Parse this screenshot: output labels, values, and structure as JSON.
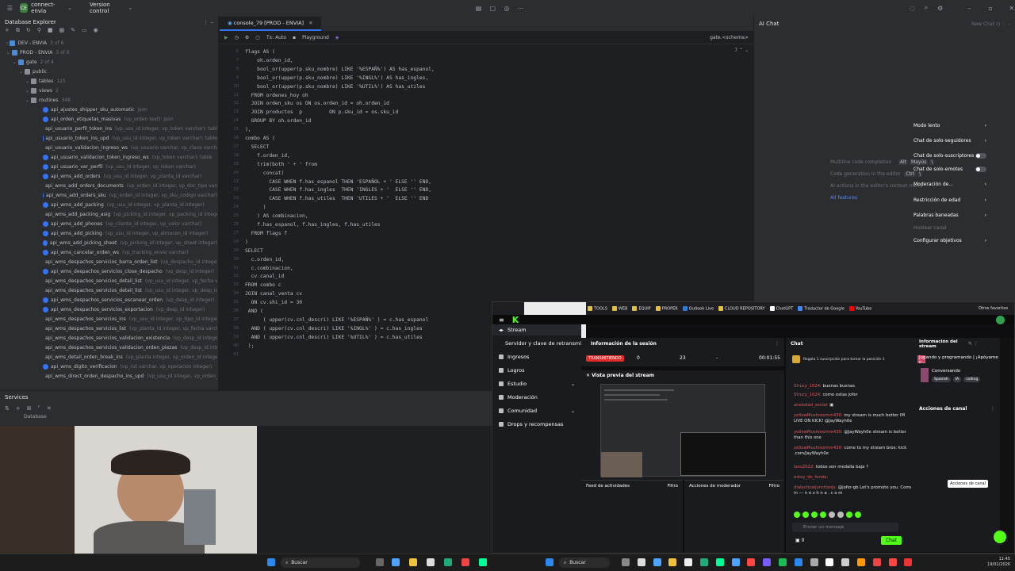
{
  "titlebar": {
    "project_badge": "CE",
    "project_name": "connect-envia",
    "vcs": "Version control"
  },
  "db_explorer": {
    "title": "Database Explorer",
    "nodes": [
      {
        "label": "DEV - ENVIA",
        "hint": "3 of 6"
      },
      {
        "label": "PROD - ENVIA",
        "hint": "3 of 6"
      },
      {
        "label": "gate",
        "hint": "2 of 4"
      },
      {
        "label": "public",
        "hint": ""
      },
      {
        "label": "tables",
        "hint": "125"
      },
      {
        "label": "views",
        "hint": "2"
      },
      {
        "label": "routines",
        "hint": "348"
      }
    ],
    "routines": [
      {
        "name": "api_ajustes_shipper_sku_automatic",
        "hint": "json"
      },
      {
        "name": "api_orden_etiquetas_masivas",
        "hint": "(vp_orden text): json"
      },
      {
        "name": "api_usuario_perfil_token_ins",
        "hint": "(vp_usu_id integer, vp_token varchar): table"
      },
      {
        "name": "api_usuario_token_ins_upd",
        "hint": "(vp_usu_id integer, vp_token varchar): table"
      },
      {
        "name": "api_usuario_validacion_ingreso_ws",
        "hint": "(vp_usuario varchar, vp_clave varchar)"
      },
      {
        "name": "api_usuario_validacion_token_ingreso_ws",
        "hint": "(vp_token varchar): table"
      },
      {
        "name": "api_usuario_ver_perfil",
        "hint": "(vp_usu_id integer, vp_token varchar)"
      },
      {
        "name": "api_wms_add_orders",
        "hint": "(vp_usu_id integer, vp_planta_id varchar)"
      },
      {
        "name": "api_wms_add_orders_documents",
        "hint": "(vp_orden_id integer, vp_doc_tipo varchar)"
      },
      {
        "name": "api_wms_add_orders_sku",
        "hint": "(vp_orden_id integer, vp_sku_codigo varchar)"
      },
      {
        "name": "api_wms_add_packing",
        "hint": "(vp_usu_id integer, vp_planta_id integer)"
      },
      {
        "name": "api_wms_add_packing_asig",
        "hint": "(vp_picking_id integer, vp_packing_id integer)"
      },
      {
        "name": "api_wms_add_phones",
        "hint": "(vp_cliente_id integer, vp_valor varchar)"
      },
      {
        "name": "api_wms_add_picking",
        "hint": "(vp_usu_id integer, vp_almacen_id integer)"
      },
      {
        "name": "api_wms_add_picking_sheet",
        "hint": "(vp_picking_id integer, vp_sheet integer)"
      },
      {
        "name": "api_wms_cancelar_orden_ws",
        "hint": "(vp_tracking_envio varchar)"
      },
      {
        "name": "api_wms_despachos_servicios_barra_orden_list",
        "hint": "(vp_despacho_id integer)"
      },
      {
        "name": "api_wms_despachos_servicios_close_despacho",
        "hint": "(vp_desp_id integer)"
      },
      {
        "name": "api_wms_despachos_servicios_detail_list",
        "hint": "(vp_usu_id integer, vp_fecha varchar)"
      },
      {
        "name": "api_wms_despachos_servicios_detail_list",
        "hint": "(vp_usu_id integer, vp_desp_id integer)"
      },
      {
        "name": "api_wms_despachos_servicios_escanear_orden",
        "hint": "(vp_desp_id integer)"
      },
      {
        "name": "api_wms_despachos_servicios_exportacion",
        "hint": "(vp_desp_id integer)"
      },
      {
        "name": "api_wms_despachos_servicios_ins",
        "hint": "(vp_usu_id integer, vp_tipo_id integer)"
      },
      {
        "name": "api_wms_despachos_servicios_list",
        "hint": "(vp_planta_id integer, vp_fecha varchar)"
      },
      {
        "name": "api_wms_despachos_servicios_validacion_existencia",
        "hint": "(vp_desp_id integer)"
      },
      {
        "name": "api_wms_despachos_servicios_validacion_orden_piezas",
        "hint": "(vp_desp_id integer)"
      },
      {
        "name": "api_wms_detail_orden_break_ins",
        "hint": "(vp_planta integer, vp_orden_id integer)"
      },
      {
        "name": "api_wms_digito_verificacion",
        "hint": "(vp_rut varchar, vp_operacion integer)"
      },
      {
        "name": "api_wms_direct_orden_despacho_ins_upd",
        "hint": "(vp_usu_id integer, vp_orden_id integer)"
      }
    ]
  },
  "services": {
    "title": "Services",
    "node": "Database"
  },
  "editor": {
    "tab": "console_79 [PROD - ENVIA]",
    "toolbar": {
      "tx": "Tx: Auto",
      "playground": "Playground",
      "schema": "gate.<schema>",
      "count": "7"
    },
    "lines": [
      {
        "n": "6",
        "t": "flags AS ("
      },
      {
        "n": "7",
        "t": "    oh.orden_id,"
      },
      {
        "n": "8",
        "t": "    bool_or(upper(p.sku_nombre) LIKE '%ESPAÑ%') AS has_espanol,"
      },
      {
        "n": "9",
        "t": "    bool_or(upper(p.sku_nombre) LIKE '%INGL%') AS has_ingles,"
      },
      {
        "n": "10",
        "t": "    bool_or(upper(p.sku_nombre) LIKE '%UTIL%') AS has_utiles"
      },
      {
        "n": "11",
        "t": "  FROM ordenes_hoy oh"
      },
      {
        "n": "12",
        "t": "  JOIN orden_sku os ON os.orden_id = oh.orden_id"
      },
      {
        "n": "13",
        "t": "  JOIN productos  p         ON p.sku_id = os.sku_id"
      },
      {
        "n": "14",
        "t": "  GROUP BY oh.orden_id"
      },
      {
        "n": "15",
        "t": "),"
      },
      {
        "n": "16",
        "t": "combo AS ("
      },
      {
        "n": "17",
        "t": "  SELECT"
      },
      {
        "n": "18",
        "t": "    f.orden_id,"
      },
      {
        "n": "19",
        "t": "    trim(both ' + ' from"
      },
      {
        "n": "20",
        "t": "      concat("
      },
      {
        "n": "21",
        "t": "        CASE WHEN f.has_espanol THEN 'ESPAÑOL + ' ELSE '' END,"
      },
      {
        "n": "22",
        "t": "        CASE WHEN f.has_ingles  THEN 'INGLES + '  ELSE '' END,"
      },
      {
        "n": "23",
        "t": "        CASE WHEN f.has_utiles  THEN 'UTILES + '  ELSE '' END"
      },
      {
        "n": "24",
        "t": "      )"
      },
      {
        "n": "25",
        "t": "    ) AS combinacion,"
      },
      {
        "n": "26",
        "t": "    f.has_espanol, f.has_ingles, f.has_utiles"
      },
      {
        "n": "27",
        "t": "  FROM flags f"
      },
      {
        "n": "28",
        "t": ")"
      },
      {
        "n": "29",
        "t": "SELECT"
      },
      {
        "n": "30",
        "t": "  c.orden_id,"
      },
      {
        "n": "31",
        "t": "  c.combinacion,"
      },
      {
        "n": "32",
        "t": "  cv.canal_id"
      },
      {
        "n": "33",
        "t": "FROM combo c"
      },
      {
        "n": "34",
        "t": "JOIN canal_venta cv"
      },
      {
        "n": "35",
        "t": "  ON cv.shi_id = 30"
      },
      {
        "n": "36",
        "t": " AND ("
      },
      {
        "n": "37",
        "t": "      ( upper(cv.cnl_descri) LIKE '%ESPAÑ%' ) = c.has_espanol"
      },
      {
        "n": "38",
        "t": "  AND ( upper(cv.cnl_descri) LIKE '%INGL%' ) = c.has_ingles"
      },
      {
        "n": "39",
        "t": "  AND ( upper(cv.cnl_descri) LIKE '%UTIL%' ) = c.has_utiles"
      },
      {
        "n": "40",
        "t": " );"
      },
      {
        "n": "41",
        "t": ""
      }
    ]
  },
  "ai_chat": {
    "title": "AI Chat",
    "new_chat": "New Chat",
    "hint1": "Multiline code completion",
    "hint1_keys": [
      "Alt",
      "Mayús",
      "\\"
    ],
    "hint2": "Code generation in the editor",
    "hint2_keys": [
      "Ctrl",
      "\\"
    ],
    "hint3": "AI actions in the editor's context menu",
    "all_features": "All features"
  },
  "browser": {
    "bookmarks": [
      "TOOLS",
      "WEB",
      "EQUIP",
      "PROPER",
      "Outlook Live",
      "CLOUD REPOSITORY",
      "ChatGPT",
      "Traductor de Google",
      "YouTube"
    ],
    "other_bookmarks": "Otros favoritos",
    "sidebar": {
      "stream": "Stream",
      "server_key": "Servidor y clave de retransmi...",
      "items": [
        "Ingresos",
        "Logros",
        "Estudio",
        "Moderación",
        "Comunidad",
        "Drops y recompensas"
      ]
    },
    "session": {
      "title": "Información de la sesión",
      "status": "TRANSMITIENDO",
      "viewers": "0",
      "followers": "23",
      "dash": "-",
      "time": "00:01:55"
    },
    "preview_title": "Vista previa del stream",
    "activity_feed": "Feed de actividades",
    "filter": "Filtro",
    "mod_actions": "Acciones de moderador",
    "filter2": "Filtro",
    "chat": {
      "title": "Chat",
      "gift": "Regala 1 suscripción para tomar la posición 1",
      "messages": [
        {
          "user": "Strucy_1024:",
          "text": " buenas buenas"
        },
        {
          "user": "Strucy_1024:",
          "text": " como estas jofer"
        },
        {
          "user": "ansiedad_social:",
          "text": " ▣"
        },
        {
          "user": "yellowMushroomm430:",
          "text": " my stream is much better IM LIVE ON KICK! @JayWayh0e"
        },
        {
          "user": "yellowMushroomm430:",
          "text": " @JayWayh0e stream is better than this one"
        },
        {
          "user": "yellowMushroomm430:",
          "text": " come to my stream bros: kick .com/JayWayh0e"
        },
        {
          "user": "lans2022:",
          "text": " todos son medalla baja ?"
        },
        {
          "user": "estoy_de_fondo:",
          "text": ""
        },
        {
          "user": "dialecticaljunctionjs:",
          "text": " @jofer-gb Let's promote you. Come in --- n e z h n a . c o m"
        }
      ],
      "input_placeholder": "Enviar un mensaje",
      "points": "0",
      "send": "Chat"
    },
    "right_panel": {
      "info_title": "Información del stream",
      "stream_title": "Jugando y programando | ¡Apóyame c...",
      "category": "Conversando",
      "tags": [
        "Spanish",
        "IA",
        "coding"
      ],
      "channel_actions": "Acciones de canal",
      "items": [
        "Modo lento",
        "Chat de solo-seguidores",
        "Chat de solo-suscriptores",
        "Chat de solo-emotes",
        "Moderación de...",
        "Restricción de edad",
        "Palabras baneadas",
        "Hostear canal",
        "Configurar objetivos"
      ],
      "tooltip": "Acciones de canal"
    }
  },
  "taskbar": {
    "search": "Buscar",
    "search2": "Buscar",
    "time": "11:45",
    "date": "19/01/2026"
  }
}
